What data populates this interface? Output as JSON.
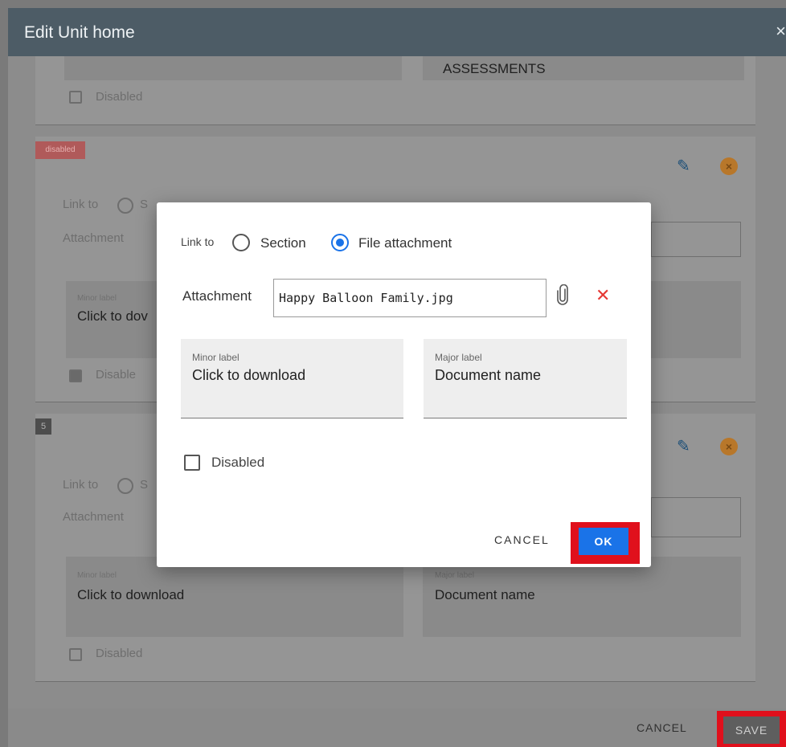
{
  "outer_dialog": {
    "title": "Edit Unit home",
    "close_glyph": "×",
    "footer": {
      "cancel_label": "CANCEL",
      "save_label": "SAVE"
    }
  },
  "background": {
    "card1": {
      "major_value": "ASSESSMENTS",
      "disabled_label": "Disabled"
    },
    "card2": {
      "badge": "disabled",
      "link_to": "Link to",
      "radio_partial": "S",
      "attachment_label": "Attachment",
      "minor_label": "Minor label",
      "minor_value": "Click to dov",
      "disabled_label": "Disable"
    },
    "card3": {
      "badge": "5",
      "link_to": "Link to",
      "radio_partial": "S",
      "attachment_label": "Attachment",
      "minor_label": "Minor label",
      "minor_value": "Click to download",
      "major_label": "Major label",
      "major_value": "Document name",
      "disabled_label": "Disabled"
    }
  },
  "modal": {
    "link_to_label": "Link to",
    "options": [
      {
        "label": "Section",
        "selected": false
      },
      {
        "label": "File attachment",
        "selected": true
      }
    ],
    "attachment_label": "Attachment",
    "attachment_value": "Happy Balloon Family.jpg",
    "minor_label_caption": "Minor label",
    "minor_label_value": "Click to download",
    "major_label_caption": "Major label",
    "major_label_value": "Document name",
    "disabled_label": "Disabled",
    "cancel_label": "CANCEL",
    "ok_label": "OK"
  },
  "colors": {
    "accent": "#1a73e8",
    "highlight": "#e0101c",
    "delete": "#e53935",
    "header": "#4d5c66"
  },
  "icons": [
    "close-icon",
    "pencil-icon",
    "remove-circle-icon",
    "paperclip-icon",
    "delete-x-icon"
  ]
}
